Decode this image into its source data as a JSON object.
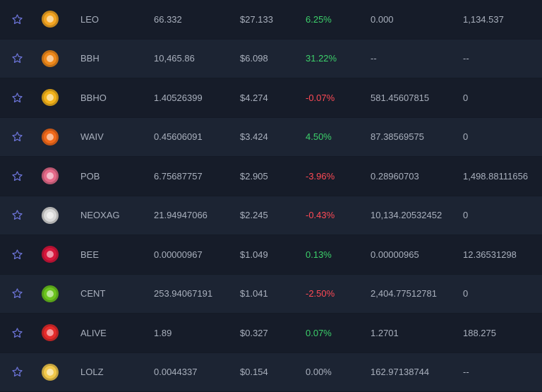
{
  "rows": [
    {
      "symbol": "LEO",
      "amount": "66.332",
      "price": "$27.133",
      "change": "6.25%",
      "trend": "pos",
      "volume": "0.000",
      "market_cap": "1,134.537",
      "icon": "leo-token-icon",
      "icon_color": "#f5a623"
    },
    {
      "symbol": "BBH",
      "amount": "10,465.86",
      "price": "$6.098",
      "change": "31.22%",
      "trend": "pos",
      "volume": "--",
      "market_cap": "--",
      "icon": "bbh-token-icon",
      "icon_color": "#f08a1c"
    },
    {
      "symbol": "BBHO",
      "amount": "1.40526399",
      "price": "$4.274",
      "change": "-0.07%",
      "trend": "neg",
      "volume": "581.45607815",
      "market_cap": "0",
      "icon": "bbho-token-icon",
      "icon_color": "#f3b31b"
    },
    {
      "symbol": "WAIV",
      "amount": "0.45606091",
      "price": "$3.424",
      "change": "4.50%",
      "trend": "pos",
      "volume": "87.38569575",
      "market_cap": "0",
      "icon": "waiv-token-icon",
      "icon_color": "#f26a1b"
    },
    {
      "symbol": "POB",
      "amount": "6.75687757",
      "price": "$2.905",
      "change": "-3.96%",
      "trend": "neg",
      "volume": "0.28960703",
      "market_cap": "1,498.88111656",
      "icon": "pob-brain-token-icon",
      "icon_color": "#e56b8a"
    },
    {
      "symbol": "NEOXAG",
      "amount": "21.94947066",
      "price": "$2.245",
      "change": "-0.43%",
      "trend": "neg",
      "volume": "10,134.20532452",
      "market_cap": "0",
      "icon": "neoxag-token-icon",
      "icon_color": "#d8d8d8"
    },
    {
      "symbol": "BEE",
      "amount": "0.00000967",
      "price": "$1.049",
      "change": "0.13%",
      "trend": "pos",
      "volume": "0.00000965",
      "market_cap": "12.36531298",
      "icon": "bee-token-icon",
      "icon_color": "#d8163c"
    },
    {
      "symbol": "CENT",
      "amount": "253.94067191",
      "price": "$1.041",
      "change": "-2.50%",
      "trend": "neg",
      "volume": "2,404.77512781",
      "market_cap": "0",
      "icon": "cent-token-icon",
      "icon_color": "#6cc51f"
    },
    {
      "symbol": "ALIVE",
      "amount": "1.89",
      "price": "$0.327",
      "change": "0.07%",
      "trend": "pos",
      "volume": "1.2701",
      "market_cap": "188.275",
      "icon": "alive-heart-token-icon",
      "icon_color": "#e52b2b"
    },
    {
      "symbol": "LOLZ",
      "amount": "0.0044337",
      "price": "$0.154",
      "change": "0.00%",
      "trend": "zero",
      "volume": "162.97138744",
      "market_cap": "--",
      "icon": "lolz-token-icon",
      "icon_color": "#f2c94c"
    }
  ],
  "colors": {
    "star": "#6b73d6",
    "positive": "#3ccf6a",
    "negative": "#ff4a55"
  }
}
